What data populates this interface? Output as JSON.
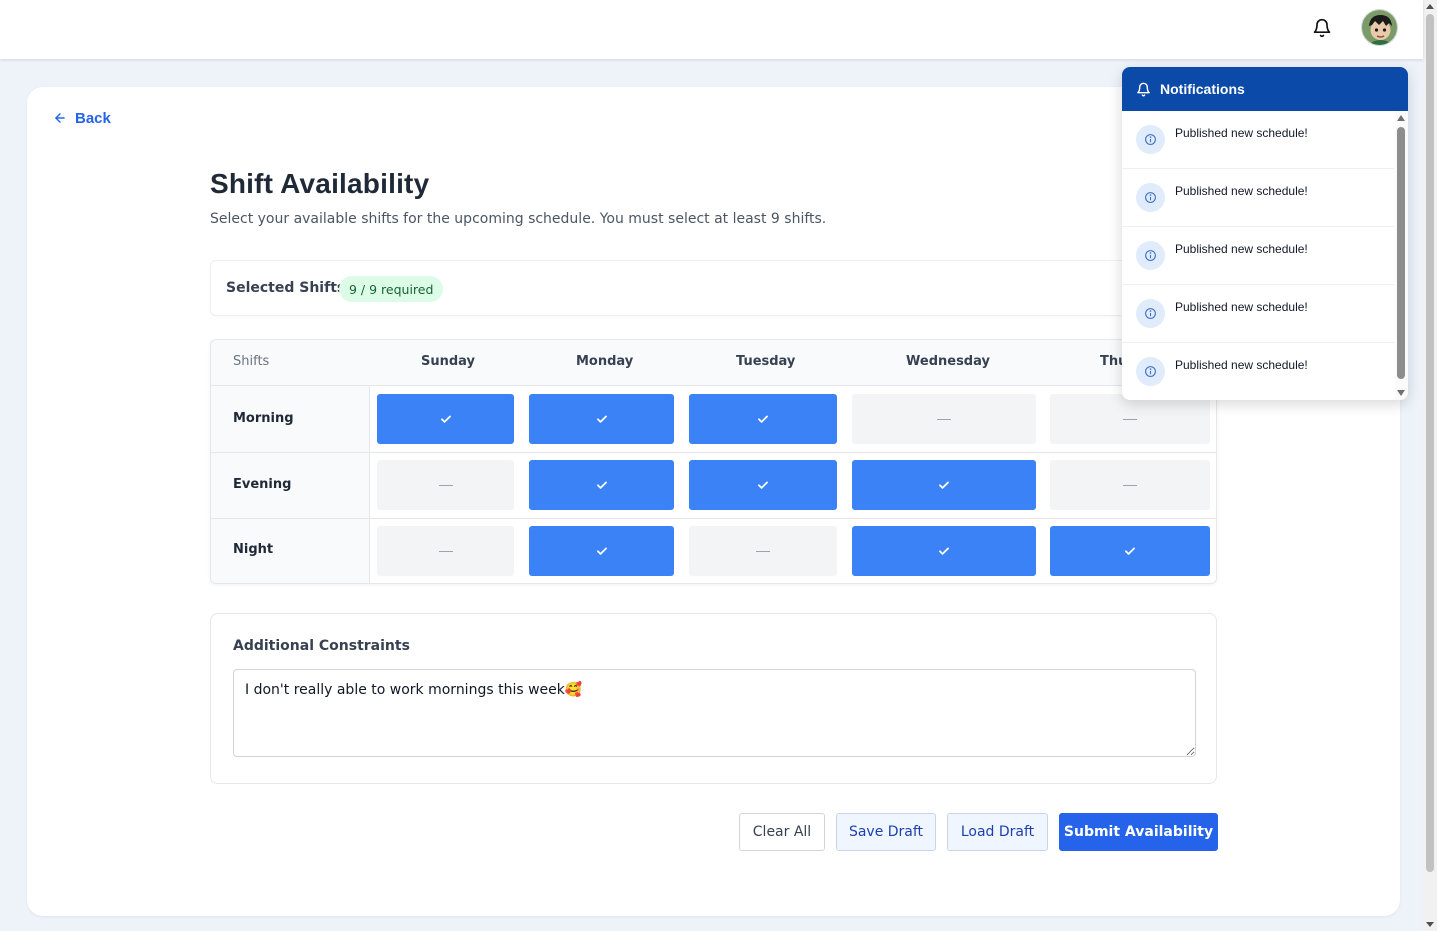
{
  "header": {
    "bell_icon": "bell-icon",
    "avatar_icon": "user-avatar"
  },
  "back": {
    "label": "Back"
  },
  "page": {
    "title": "Shift Availability",
    "subtitle": "Select your available shifts for the upcoming schedule. You must select at least 9 shifts."
  },
  "selected": {
    "label": "Selected Shifts:",
    "badge": "9 / 9 required"
  },
  "grid": {
    "shifts_header": "Shifts",
    "days": [
      "Sunday",
      "Monday",
      "Tuesday",
      "Wednesday",
      "Thu"
    ],
    "rows": [
      {
        "label": "Morning",
        "cells": [
          true,
          true,
          true,
          false,
          false
        ]
      },
      {
        "label": "Evening",
        "cells": [
          false,
          true,
          true,
          true,
          false
        ]
      },
      {
        "label": "Night",
        "cells": [
          false,
          true,
          false,
          true,
          true
        ]
      }
    ]
  },
  "constraints": {
    "label": "Additional Constraints",
    "value": "I don't really able to work mornings this week🥰"
  },
  "actions": {
    "clear": "Clear All",
    "save": "Save Draft",
    "load": "Load Draft",
    "submit": "Submit Availability"
  },
  "notifications": {
    "title": "Notifications",
    "items": [
      "Published new schedule!",
      "Published new schedule!",
      "Published new schedule!",
      "Published new schedule!",
      "Published new schedule!"
    ]
  },
  "colors": {
    "accent": "#2563eb",
    "selected_cell": "#3b82f6",
    "header_blue": "#0b4aa8",
    "badge_bg": "#dcfce7"
  }
}
